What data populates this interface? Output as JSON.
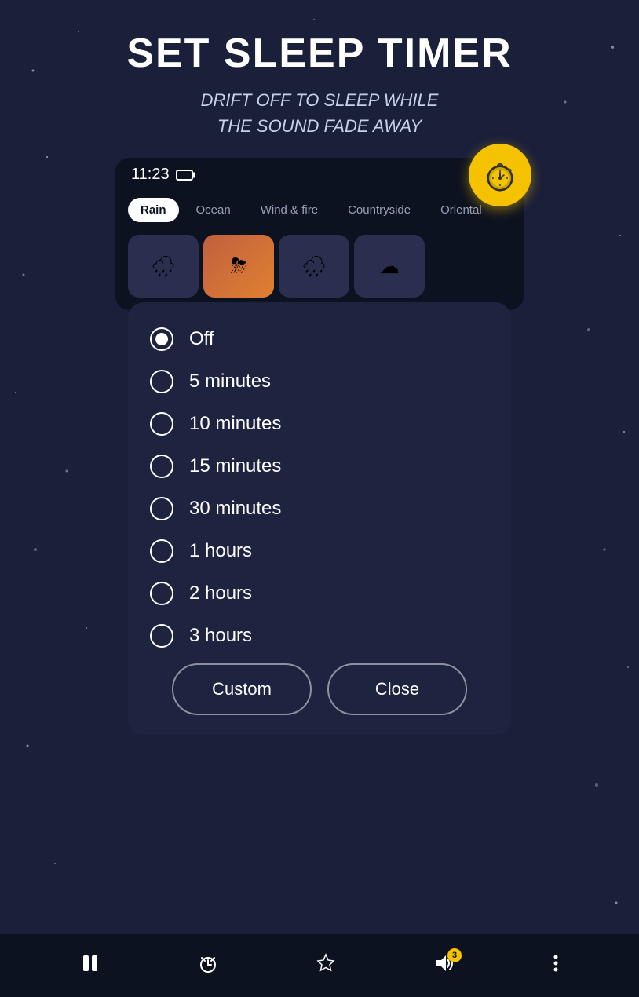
{
  "page": {
    "title": "SET SLEEP TIMER",
    "subtitle_line1": "Drift off to sleep while",
    "subtitle_line2": "the sound fade away"
  },
  "phone": {
    "time": "11:23"
  },
  "timer_icon": "⏱",
  "sound_tabs": [
    {
      "label": "Rain",
      "active": true
    },
    {
      "label": "Ocean",
      "active": false
    },
    {
      "label": "Wind & fire",
      "active": false
    },
    {
      "label": "Countryside",
      "active": false
    },
    {
      "label": "Oriental",
      "active": false
    }
  ],
  "sound_tiles": [
    {
      "icon": "🌧",
      "active": false
    },
    {
      "icon": "⛈",
      "active": true
    },
    {
      "icon": "⛈",
      "active": false
    },
    {
      "icon": "☁",
      "active": false
    }
  ],
  "timer_options": [
    {
      "label": "Off",
      "selected": true
    },
    {
      "label": "5 minutes",
      "selected": false
    },
    {
      "label": "10 minutes",
      "selected": false
    },
    {
      "label": "15 minutes",
      "selected": false
    },
    {
      "label": "30 minutes",
      "selected": false
    },
    {
      "label": "1 hours",
      "selected": false
    },
    {
      "label": "2 hours",
      "selected": false
    },
    {
      "label": "3 hours",
      "selected": false
    }
  ],
  "buttons": {
    "custom": "Custom",
    "close": "Close"
  },
  "bottom_nav": {
    "pause_icon": "⏸",
    "timer_icon": "⏱",
    "star_icon": "☆",
    "volume_icon": "🔊",
    "badge": "3",
    "more_icon": "⋮"
  },
  "colors": {
    "background": "#1a1f3a",
    "panel": "#1e2340",
    "phone_bg": "#0d1220",
    "accent": "#f5c200",
    "text_white": "#ffffff",
    "tab_active_bg": "#ffffff",
    "tab_active_text": "#0d1220"
  }
}
